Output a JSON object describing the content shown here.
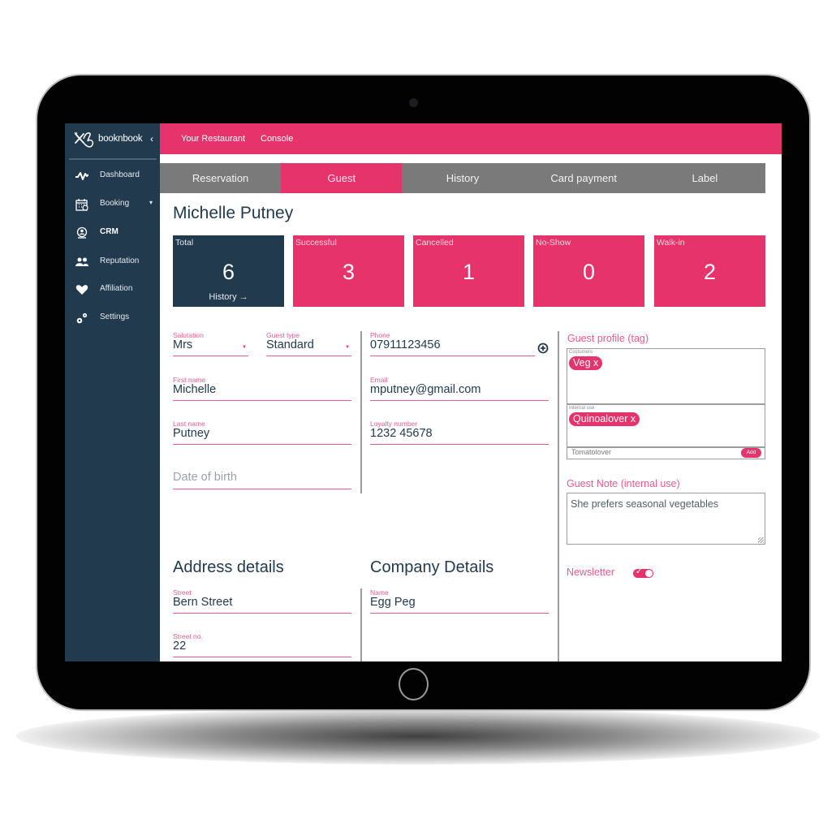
{
  "app": {
    "brand": "booknbook",
    "collapse_icon": "chevron-left-icon"
  },
  "topbar": {
    "links": [
      "Your Restaurant",
      "Console"
    ]
  },
  "sidebar": {
    "items": [
      {
        "label": "Dashboard",
        "icon": "activity-icon",
        "active": false
      },
      {
        "label": "Booking",
        "icon": "calendar-icon",
        "active": false,
        "has_dropdown": true
      },
      {
        "label": "CRM",
        "icon": "crm-icon",
        "active": true
      },
      {
        "label": "Reputation",
        "icon": "users-icon",
        "active": false
      },
      {
        "label": "Affiliation",
        "icon": "heart-icon",
        "active": false
      },
      {
        "label": "Settings",
        "icon": "gears-icon",
        "active": false
      }
    ]
  },
  "tabs": [
    {
      "label": "Reservation",
      "active": false
    },
    {
      "label": "Guest",
      "active": true
    },
    {
      "label": "History",
      "active": false
    },
    {
      "label": "Card payment",
      "active": false
    },
    {
      "label": "Label",
      "active": false
    }
  ],
  "guest": {
    "name": "Michelle Putney"
  },
  "stats": [
    {
      "label": "Total",
      "value": "6",
      "link": "History →"
    },
    {
      "label": "Successful",
      "value": "3"
    },
    {
      "label": "Cancelled",
      "value": "1"
    },
    {
      "label": "No-Show",
      "value": "0"
    },
    {
      "label": "Walk-in",
      "value": "2"
    }
  ],
  "form": {
    "salutation": {
      "label": "Salutation",
      "value": "Mrs"
    },
    "guest_type": {
      "label": "Guest type",
      "value": "Standard"
    },
    "first_name": {
      "label": "First name",
      "value": "Michelle"
    },
    "last_name": {
      "label": "Last name",
      "value": "Putney"
    },
    "date_of_birth": {
      "placeholder": "Date of birth"
    },
    "phone": {
      "label": "Phone",
      "value": "07911123456"
    },
    "email": {
      "label": "Email",
      "value": "mputney@gmail.com"
    },
    "loyalty": {
      "label": "Loyalty number",
      "value": "1232 45678"
    }
  },
  "guest_profile": {
    "title": "Guest profile (tag)",
    "costumers_label": "Costumers",
    "costumers_tags": [
      "Veg x"
    ],
    "internal_label": "Internal use",
    "internal_tags": [
      "Quinoalover x"
    ],
    "new_tag_value": "Tomatolover",
    "add_label": "Add"
  },
  "guest_note": {
    "title": "Guest Note (internal use)",
    "value": "She prefers seasonal vegetables"
  },
  "newsletter": {
    "label": "Newsletter",
    "enabled": true
  },
  "address": {
    "title": "Address details",
    "street": {
      "label": "Street",
      "value": "Bern Street"
    },
    "street_no": {
      "label": "Street no.",
      "value": "22"
    }
  },
  "company": {
    "title": "Company Details",
    "name": {
      "label": "Name",
      "value": "Egg Peg"
    }
  },
  "colors": {
    "accent": "#e6336b",
    "sidebar": "#213a4e",
    "tab_inactive": "#7a7a7a",
    "text_dark": "#223a4e"
  }
}
